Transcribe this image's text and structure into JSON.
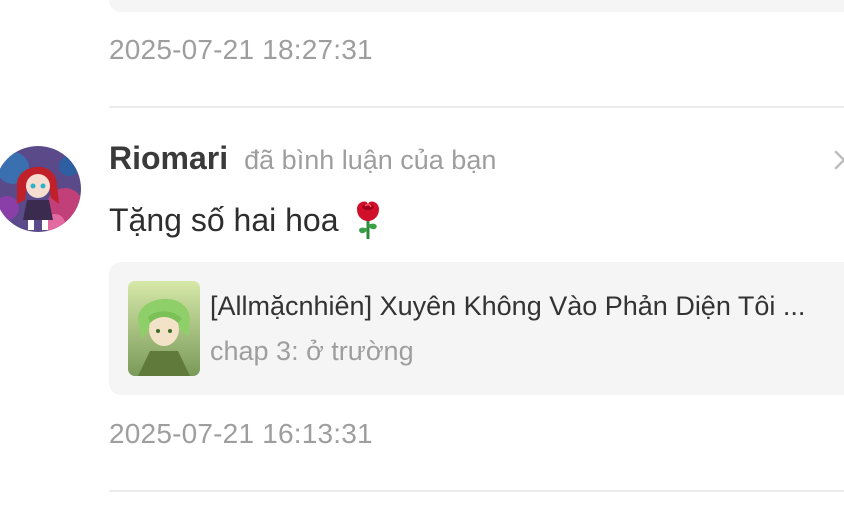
{
  "previous_item": {
    "timestamp": "2025-07-21 18:27:31"
  },
  "notification": {
    "username": "Riomari",
    "action": "đã bình luận của bạn",
    "comment": "Tặng số hai hoa",
    "comment_emoji": "rose-icon",
    "story": {
      "title": "[Allmặcnhiên] Xuyên Không Vào Phản Diện Tôi ...",
      "chapter": "chap 3: ở trường"
    },
    "timestamp": "2025-07-21 16:13:31"
  },
  "colors": {
    "background": "#ffffff",
    "card": "#f5f5f5",
    "muted_text": "#9e9e9e",
    "primary_text": "#2e2e2e",
    "divider": "#ececec"
  }
}
